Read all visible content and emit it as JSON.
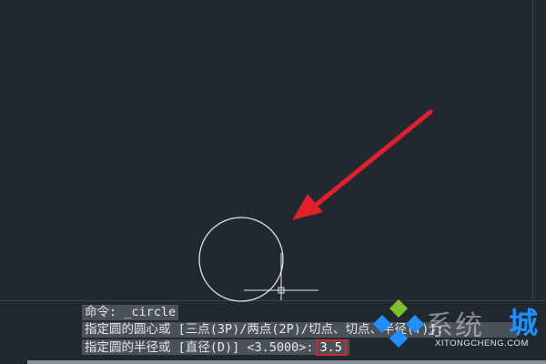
{
  "command_line": {
    "line1": "命令: _circle",
    "line2": "指定圆的圆心或 [三点(3P)/两点(2P)/切点、切点、半径(T)]:",
    "line3_prompt": "指定圆的半径或 [直径(D)] <3.5000>:",
    "line3_input": "3.5"
  },
  "watermark": {
    "text": "系统",
    "highlight_char": "城",
    "sub": "XITONGCHENG.COM"
  },
  "colors": {
    "background": "#212830",
    "arrow": "#e0202a",
    "input_box_border": "#d1262a",
    "watermark_blue": "#1e90ff",
    "watermark_green": "#7dc22a"
  },
  "icons": [
    "cursor-crosshair-icon",
    "pointer-arrow-icon",
    "site-logo-icon"
  ]
}
